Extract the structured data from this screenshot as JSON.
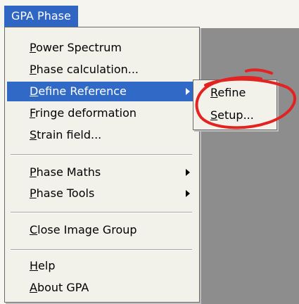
{
  "menubar": {
    "title_label": "GPA Phase"
  },
  "menu": {
    "items": [
      {
        "label_first": "P",
        "label_rest": "ower Spectrum"
      },
      {
        "label_first": "P",
        "label_rest": "hase calculation..."
      },
      {
        "label_first": "D",
        "label_rest": "efine Reference"
      },
      {
        "label_first": "F",
        "label_rest": "ringe deformation"
      },
      {
        "label_first": "S",
        "label_rest": "train field..."
      },
      {
        "label_first": "P",
        "label_rest": "hase Maths"
      },
      {
        "label_first": "P",
        "label_rest": "hase Tools"
      },
      {
        "label_first": "C",
        "label_rest": "lose Image Group"
      },
      {
        "label_first": "H",
        "label_rest": "elp"
      },
      {
        "label_first": "A",
        "label_rest": "bout GPA"
      }
    ]
  },
  "submenu": {
    "items": [
      {
        "label_first": "R",
        "label_rest": "efine"
      },
      {
        "label_first": "S",
        "label_rest": "etup..."
      }
    ]
  },
  "colors": {
    "menu_highlight": "#3169c6",
    "annotation_circle": "#e32222"
  }
}
